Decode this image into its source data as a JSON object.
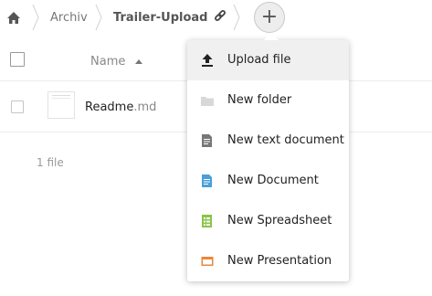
{
  "breadcrumb": {
    "home_icon": "home-icon",
    "items": [
      {
        "label": "Archiv"
      },
      {
        "label": "Trailer-Upload"
      }
    ],
    "share_icon": "link-icon",
    "new_button_label": "+"
  },
  "file_list": {
    "header": {
      "name_label": "Name",
      "sort": "ascending"
    },
    "files": [
      {
        "base": "Readme",
        "ext": ".md"
      }
    ],
    "summary": "1 file"
  },
  "new_menu": {
    "items": [
      {
        "label": "Upload file",
        "icon": "upload-icon",
        "color": "#222222"
      },
      {
        "label": "New folder",
        "icon": "folder-icon",
        "color": "#d8d8d8"
      },
      {
        "label": "New text document",
        "icon": "text-document-icon",
        "color": "#777777"
      },
      {
        "label": "New Document",
        "icon": "document-icon",
        "color": "#4a9fd9"
      },
      {
        "label": "New Spreadsheet",
        "icon": "spreadsheet-icon",
        "color": "#8bc34a"
      },
      {
        "label": "New Presentation",
        "icon": "presentation-icon",
        "color": "#e8873a"
      }
    ]
  }
}
